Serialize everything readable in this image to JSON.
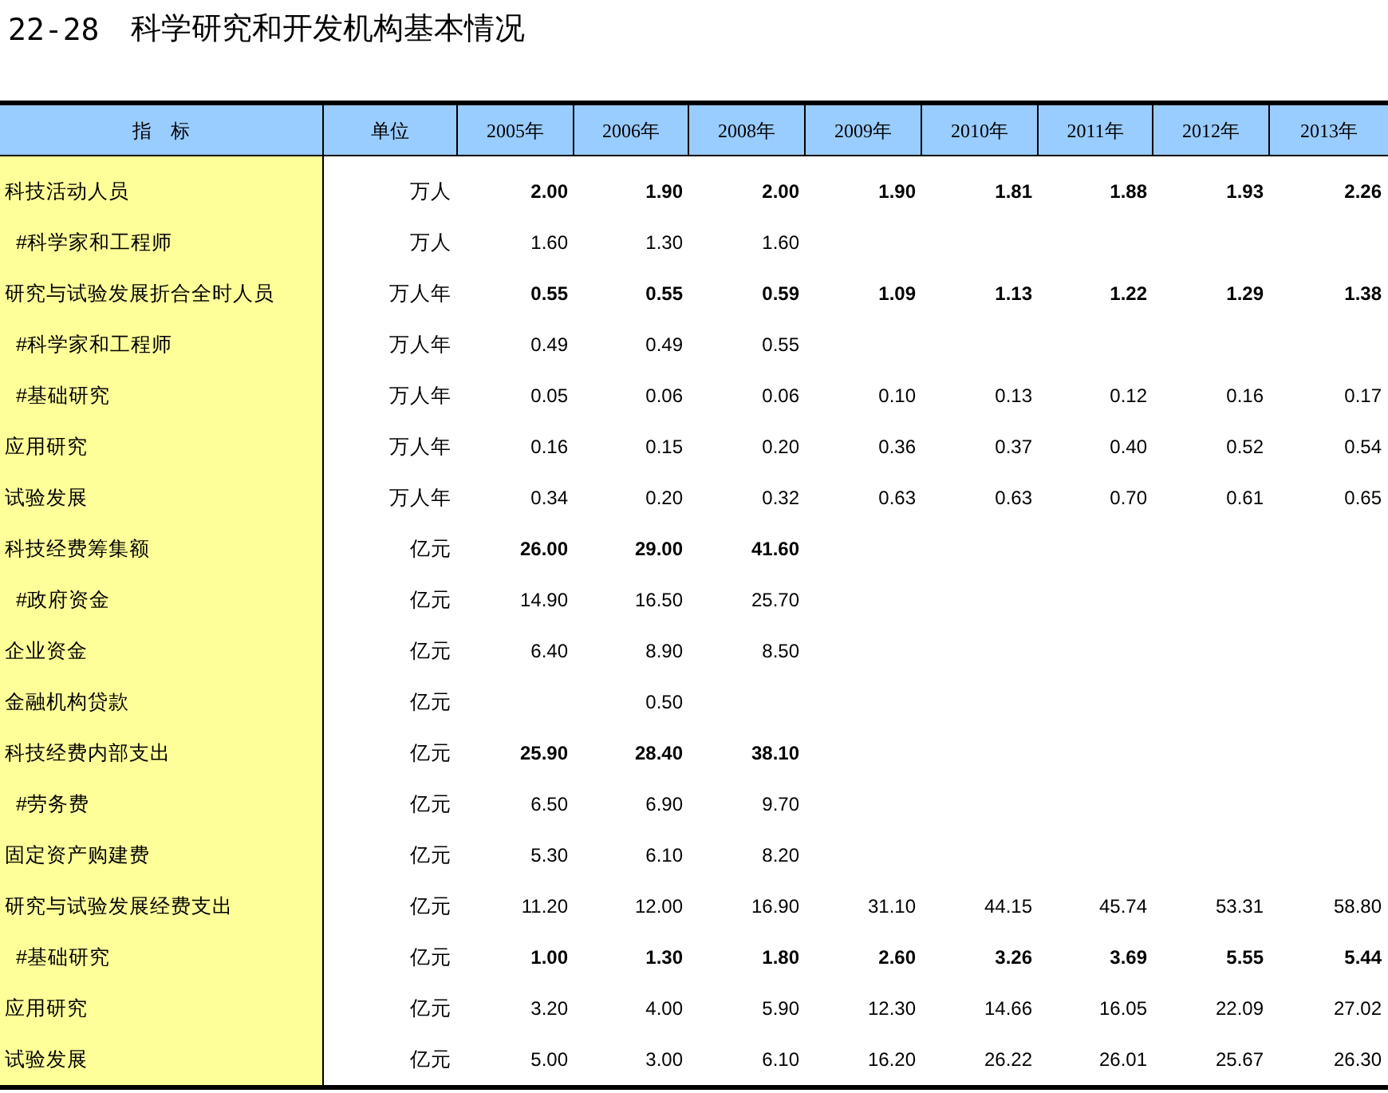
{
  "title": {
    "number": "22-28",
    "text": "科学研究和开发机构基本情况"
  },
  "table": {
    "columns": [
      "指　标",
      "单位",
      "2005年",
      "2006年",
      "2008年",
      "2009年",
      "2010年",
      "2011年",
      "2012年",
      "2013年"
    ],
    "rows": [
      {
        "label": "科技活动人员",
        "indented": false,
        "bold": true,
        "unit": "万人",
        "values": [
          {
            "value": "2.00"
          },
          {
            "value": "1.90"
          },
          {
            "value": "2.00"
          },
          {
            "value": "1.90"
          },
          {
            "value": "1.81"
          },
          {
            "value": "1.88"
          },
          {
            "value": "1.93"
          },
          {
            "value": "2.26"
          }
        ]
      },
      {
        "label": "#科学家和工程师",
        "indented": true,
        "bold": false,
        "unit": "万人",
        "values": [
          {
            "value": "1.60"
          },
          {
            "value": "1.30"
          },
          {
            "value": "1.60"
          }
        ]
      },
      {
        "label": "研究与试验发展折合全时人员",
        "indented": false,
        "bold": true,
        "unit": "万人年",
        "values": [
          {
            "value": "0.55"
          },
          {
            "value": "0.55"
          },
          {
            "value": "0.59"
          },
          {
            "value": "1.09"
          },
          {
            "value": "1.13"
          },
          {
            "value": "1.22"
          },
          {
            "value": "1.29"
          },
          {
            "value": "1.38"
          }
        ]
      },
      {
        "label": "#科学家和工程师",
        "indented": true,
        "bold": false,
        "unit": "万人年",
        "values": [
          {
            "value": "0.49"
          },
          {
            "value": "0.49"
          },
          {
            "value": "0.55"
          }
        ]
      },
      {
        "label": "#基础研究",
        "indented": true,
        "bold": false,
        "unit": "万人年",
        "values": [
          {
            "value": "0.05"
          },
          {
            "value": "0.06"
          },
          {
            "value": "0.06"
          },
          {
            "value": "0.10"
          },
          {
            "value": "0.13"
          },
          {
            "value": "0.12"
          },
          {
            "value": "0.16"
          },
          {
            "value": "0.17"
          }
        ]
      },
      {
        "label": "应用研究",
        "indented": false,
        "bold": false,
        "unit": "万人年",
        "values": [
          {
            "value": "0.16"
          },
          {
            "value": "0.15"
          },
          {
            "value": "0.20"
          },
          {
            "value": "0.36"
          },
          {
            "value": "0.37"
          },
          {
            "value": "0.40"
          },
          {
            "value": "0.52"
          },
          {
            "value": "0.54"
          }
        ]
      },
      {
        "label": "试验发展",
        "indented": false,
        "bold": false,
        "unit": "万人年",
        "values": [
          {
            "value": "0.34"
          },
          {
            "value": "0.20"
          },
          {
            "value": "0.32"
          },
          {
            "value": "0.63"
          },
          {
            "value": "0.63"
          },
          {
            "value": "0.70"
          },
          {
            "value": "0.61"
          },
          {
            "value": "0.65"
          }
        ]
      },
      {
        "label": "科技经费筹集额",
        "indented": false,
        "bold": true,
        "unit": "亿元",
        "values": [
          {
            "value": "26.00"
          },
          {
            "value": "29.00"
          },
          {
            "value": "41.60"
          }
        ]
      },
      {
        "label": "#政府资金",
        "indented": true,
        "bold": false,
        "unit": "亿元",
        "values": [
          {
            "value": "14.90"
          },
          {
            "value": "16.50"
          },
          {
            "value": "25.70"
          }
        ]
      },
      {
        "label": "企业资金",
        "indented": false,
        "bold": false,
        "unit": "亿元",
        "values": [
          {
            "value": "6.40"
          },
          {
            "value": "8.90"
          },
          {
            "value": "8.50"
          }
        ]
      },
      {
        "label": "金融机构贷款",
        "indented": false,
        "bold": false,
        "unit": "亿元",
        "values": [
          {
            "kind": "blank"
          },
          {
            "kind": "number",
            "value": "0.50"
          }
        ]
      },
      {
        "label": "科技经费内部支出",
        "indented": false,
        "bold": true,
        "unit": "亿元",
        "values": [
          {
            "value": "25.90"
          },
          {
            "value": "28.40"
          },
          {
            "value": "38.10"
          }
        ]
      },
      {
        "label": "#劳务费",
        "indented": true,
        "bold": false,
        "unit": "亿元",
        "values": [
          {
            "value": "6.50"
          },
          {
            "value": "6.90"
          },
          {
            "value": "9.70"
          }
        ]
      },
      {
        "label": "固定资产购建费",
        "indented": false,
        "bold": false,
        "unit": "亿元",
        "values": [
          {
            "value": "5.30"
          },
          {
            "value": "6.10"
          },
          {
            "value": "8.20"
          }
        ]
      },
      {
        "label": "研究与试验发展经费支出",
        "indented": false,
        "bold": false,
        "unit": "亿元",
        "values": [
          {
            "value": "11.20"
          },
          {
            "value": "12.00"
          },
          {
            "value": "16.90"
          },
          {
            "value": "31.10"
          },
          {
            "value": "44.15"
          },
          {
            "value": "45.74"
          },
          {
            "value": "53.31"
          },
          {
            "value": "58.80"
          }
        ]
      },
      {
        "label": "#基础研究",
        "indented": true,
        "bold": true,
        "unit": "亿元",
        "values": [
          {
            "value": "1.00"
          },
          {
            "value": "1.30"
          },
          {
            "value": "1.80"
          },
          {
            "value": "2.60"
          },
          {
            "value": "3.26"
          },
          {
            "value": "3.69"
          },
          {
            "value": "5.55"
          },
          {
            "value": "5.44"
          }
        ]
      },
      {
        "label": "应用研究",
        "indented": false,
        "bold": false,
        "unit": "亿元",
        "values": [
          {
            "value": "3.20"
          },
          {
            "value": "4.00"
          },
          {
            "value": "5.90"
          },
          {
            "value": "12.30"
          },
          {
            "value": "14.66"
          },
          {
            "value": "16.05"
          },
          {
            "value": "22.09"
          },
          {
            "value": "27.02"
          }
        ]
      },
      {
        "label": "试验发展",
        "indented": false,
        "bold": false,
        "unit": "亿元",
        "values": [
          {
            "value": "5.00"
          },
          {
            "value": "3.00"
          },
          {
            "value": "6.10"
          },
          {
            "value": "16.20"
          },
          {
            "value": "26.22"
          },
          {
            "value": "26.01"
          },
          {
            "value": "25.67"
          },
          {
            "value": "26.30"
          }
        ]
      }
    ]
  }
}
